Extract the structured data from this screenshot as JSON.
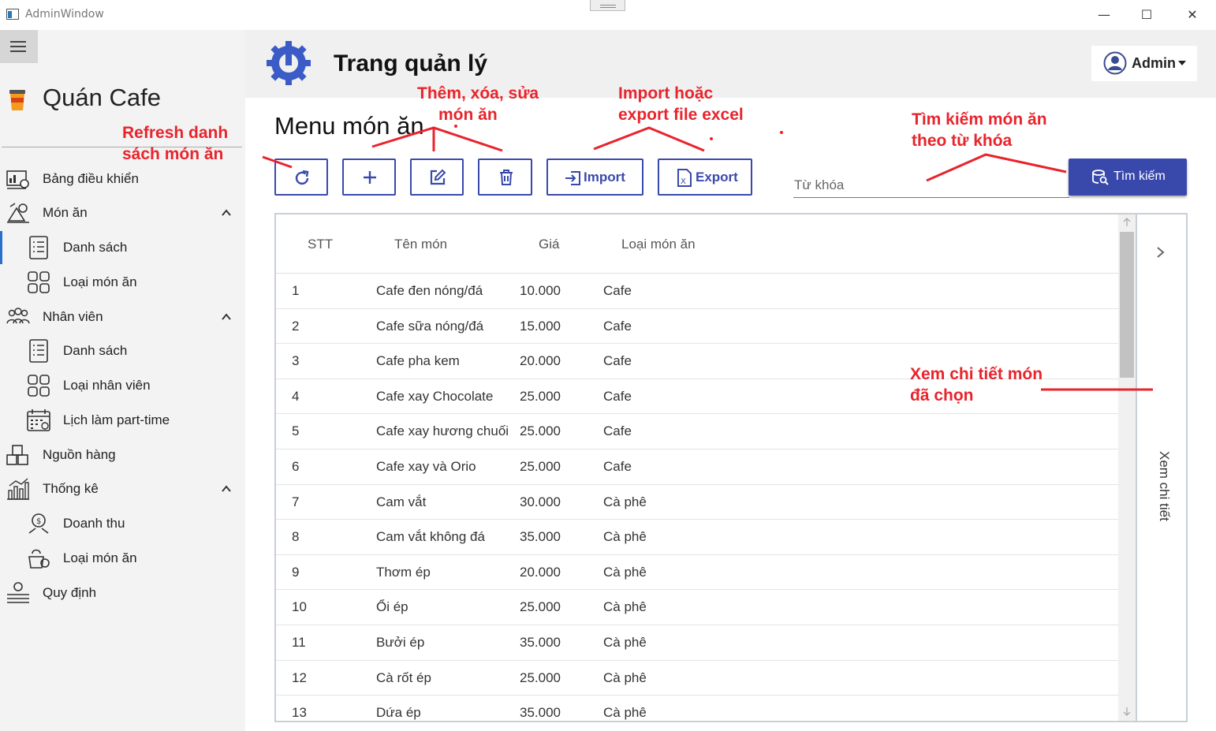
{
  "window": {
    "title": "AdminWindow",
    "minimize_glyph": "—",
    "maximize_glyph": "☐",
    "close_glyph": "✕"
  },
  "sidebar": {
    "brand": "Quán Cafe",
    "items": [
      {
        "label": "Bảng điều khiển",
        "icon": "dashboard-icon"
      },
      {
        "label": "Món ăn",
        "icon": "food-icon",
        "expanded": true
      },
      {
        "label": "Danh sách",
        "icon": "list-icon",
        "active": true
      },
      {
        "label": "Loại món ăn",
        "icon": "grid-icon"
      },
      {
        "label": "Nhân viên",
        "icon": "people-icon",
        "expanded": true
      },
      {
        "label": "Danh sách",
        "icon": "list-icon"
      },
      {
        "label": "Loại nhân viên",
        "icon": "grid-icon"
      },
      {
        "label": "Lịch làm part-time",
        "icon": "calendar-icon"
      },
      {
        "label": "Nguồn hàng",
        "icon": "boxes-icon"
      },
      {
        "label": "Thống kê",
        "icon": "chart-icon",
        "expanded": true
      },
      {
        "label": "Doanh thu",
        "icon": "revenue-icon"
      },
      {
        "label": "Loại món ăn",
        "icon": "food-category-icon"
      },
      {
        "label": "Quy định",
        "icon": "rules-icon"
      }
    ]
  },
  "header": {
    "title": "Trang quản lý",
    "user": "Admin"
  },
  "main": {
    "section_title": "Menu món ăn",
    "toolbar": {
      "import_label": "Import",
      "export_label": "Export"
    },
    "search": {
      "placeholder": "Từ khóa",
      "button_label": "Tìm kiếm"
    },
    "table": {
      "columns": [
        "STT",
        "Tên món",
        "Giá",
        "Loại món ăn"
      ],
      "rows": [
        [
          "1",
          "Cafe đen nóng/đá",
          "10.000",
          "Cafe"
        ],
        [
          "2",
          "Cafe sữa nóng/đá",
          "15.000",
          "Cafe"
        ],
        [
          "3",
          "Cafe pha kem",
          "20.000",
          "Cafe"
        ],
        [
          "4",
          "Cafe xay Chocolate",
          "25.000",
          "Cafe"
        ],
        [
          "5",
          "Cafe xay hương chuối",
          "25.000",
          "Cafe"
        ],
        [
          "6",
          "Cafe xay và Orio",
          "25.000",
          "Cafe"
        ],
        [
          "7",
          "Cam vắt",
          "30.000",
          "Cà phê"
        ],
        [
          "8",
          "Cam vắt không đá",
          "35.000",
          "Cà phê"
        ],
        [
          "9",
          "Thơm ép",
          "20.000",
          "Cà phê"
        ],
        [
          "10",
          "Ổi ép",
          "25.000",
          "Cà phê"
        ],
        [
          "11",
          "Bưởi ép",
          "35.000",
          "Cà phê"
        ],
        [
          "12",
          "Cà rốt ép",
          "25.000",
          "Cà phê"
        ],
        [
          "13",
          "Dứa ép",
          "35.000",
          "Cà phê"
        ]
      ]
    },
    "detail_panel_label": "Xem chi tiết"
  },
  "annotations": {
    "refresh": [
      "Refresh danh",
      "sách món ăn"
    ],
    "crud": [
      "Thêm, xóa, sửa",
      "món ăn"
    ],
    "excel": [
      "Import hoặc",
      "export file excel"
    ],
    "search": [
      "Tìm kiếm món ăn",
      "theo từ khóa"
    ],
    "detail": [
      "Xem chi tiết món",
      "đã chọn"
    ]
  },
  "colors": {
    "accent": "#3949ab",
    "annotation": "#e8242c",
    "sidebar_bg": "#f3f3f3",
    "header_bg": "#f0f0f0"
  }
}
